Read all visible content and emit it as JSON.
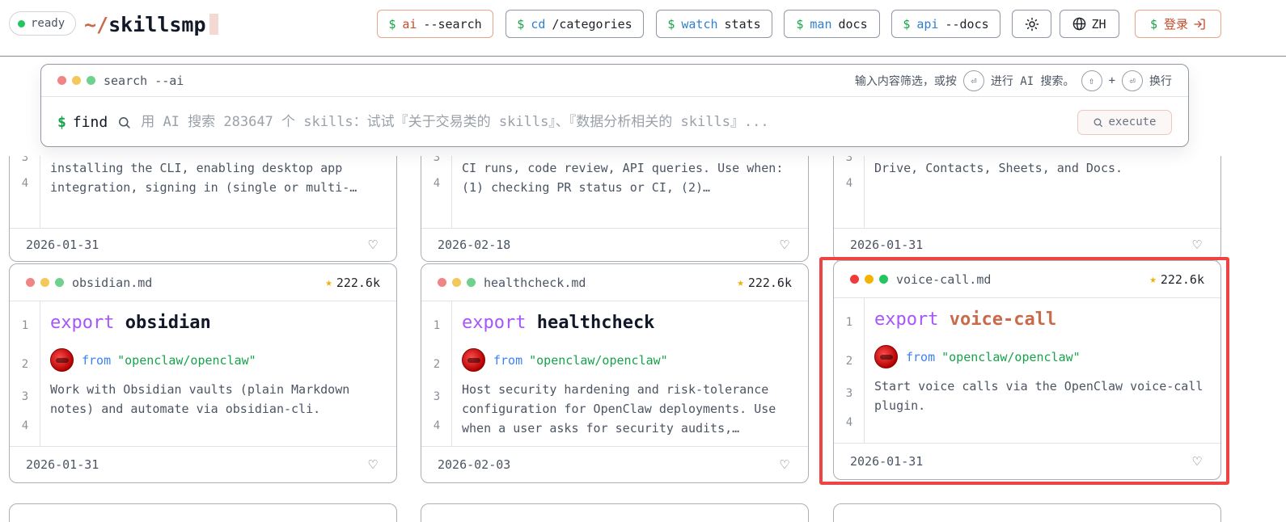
{
  "header": {
    "status": "ready",
    "logo_prefix": "~/",
    "logo_name": "skillsmp",
    "buttons": [
      {
        "dollar": "$",
        "cmd": "ai",
        "arg": "--search"
      },
      {
        "dollar": "$",
        "cmd": "cd",
        "arg": "/categories"
      },
      {
        "dollar": "$",
        "cmd": "watch",
        "arg": "stats"
      },
      {
        "dollar": "$",
        "cmd": "man",
        "arg": "docs"
      },
      {
        "dollar": "$",
        "cmd": "api",
        "arg": "--docs"
      }
    ],
    "theme_icon": "sun-icon",
    "language": "ZH",
    "login": {
      "dollar": "$",
      "label": "登录",
      "icon": "login-arrow-icon"
    }
  },
  "search": {
    "title": "search --ai",
    "hint_before": "输入内容筛选，或按",
    "hint_ai": "进行 AI 搜索。",
    "hint_plus": "+",
    "hint_newline": "换行",
    "prompt_dollar": "$",
    "prompt_cmd": "find",
    "placeholder": "用 AI 搜索 283647 个 skills：试试『关于交易类的 skills』、『数据分析相关的 skills』...",
    "value": "",
    "execute_label": "execute"
  },
  "partial_cards": [
    {
      "line3": "installing the CLI, enabling desktop app",
      "line4": "integration, signing in (single or multi-…",
      "date": "2026-01-31"
    },
    {
      "line3": "CI runs, code review, API queries. Use when:",
      "line4": "(1) checking PR status or CI, (2)…",
      "date": "2026-02-18"
    },
    {
      "line3": "Drive, Contacts, Sheets, and Docs.",
      "line4": "",
      "date": "2026-01-31"
    }
  ],
  "cards": [
    {
      "filename": "obsidian.md",
      "stars": "222.6k",
      "keyword": "export",
      "name": "obsidian",
      "from_kw": "from",
      "repo": "\"openclaw/openclaw\"",
      "description": "Work with Obsidian vaults (plain Markdown notes) and automate via obsidian-cli.",
      "date": "2026-01-31"
    },
    {
      "filename": "healthcheck.md",
      "stars": "222.6k",
      "keyword": "export",
      "name": "healthcheck",
      "from_kw": "from",
      "repo": "\"openclaw/openclaw\"",
      "description": "Host security hardening and risk-tolerance configuration for OpenClaw deployments. Use when a user asks for security audits,…",
      "date": "2026-02-03"
    },
    {
      "filename": "voice-call.md",
      "stars": "222.6k",
      "keyword": "export",
      "name": "voice-call",
      "from_kw": "from",
      "repo": "\"openclaw/openclaw\"",
      "description": "Start voice calls via the OpenClaw voice-call plugin.",
      "date": "2026-01-31"
    }
  ],
  "line_numbers": [
    "1",
    "2",
    "3",
    "4"
  ],
  "partial_line_numbers": [
    "3",
    "4"
  ],
  "colors": {
    "accent": "#c96a4a",
    "highlight": "#ef4444",
    "keyword": "#a855f7",
    "repo": "#16a34a"
  }
}
